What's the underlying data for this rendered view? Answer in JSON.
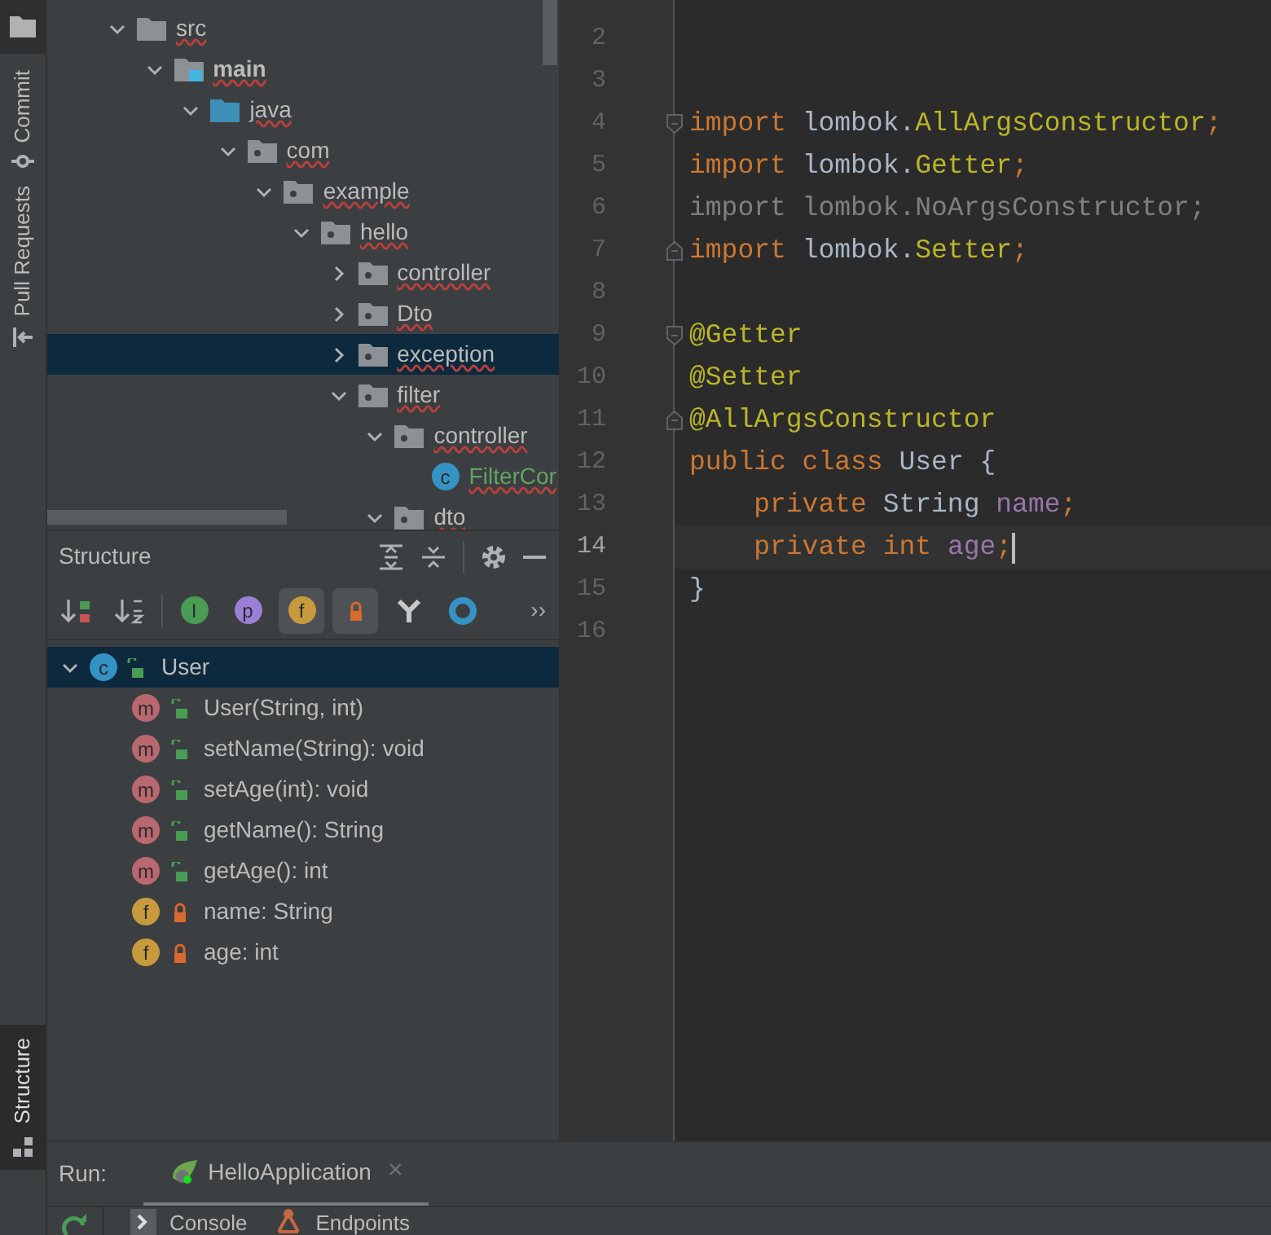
{
  "left_stripe": [
    {
      "label": "Commit",
      "kind": "commit"
    },
    {
      "label": "Pull Requests",
      "kind": "pull"
    }
  ],
  "left_stripe_bottom": {
    "label": "Structure",
    "selected": true
  },
  "project_tree": [
    {
      "label": "src",
      "kind": "folder",
      "expanded": true,
      "selected": false,
      "children": [
        {
          "label": "main",
          "kind": "source_root",
          "expanded": true,
          "selected": false,
          "children": [
            {
              "label": "java",
              "kind": "source_folder",
              "expanded": true,
              "selected": false,
              "children": [
                {
                  "label": "com",
                  "kind": "package",
                  "expanded": true,
                  "selected": false,
                  "children": [
                    {
                      "label": "example",
                      "kind": "package",
                      "expanded": true,
                      "selected": false,
                      "children": [
                        {
                          "label": "hello",
                          "kind": "package",
                          "expanded": true,
                          "selected": false,
                          "children": [
                            {
                              "label": "controller",
                              "kind": "package",
                              "expanded": false,
                              "selected": false
                            },
                            {
                              "label": "Dto",
                              "kind": "package",
                              "expanded": false,
                              "selected": false
                            },
                            {
                              "label": "exception",
                              "kind": "package",
                              "expanded": false,
                              "selected": true
                            },
                            {
                              "label": "filter",
                              "kind": "package",
                              "expanded": true,
                              "selected": false,
                              "children": [
                                {
                                  "label": "controller",
                                  "kind": "package",
                                  "expanded": true,
                                  "selected": false,
                                  "children": [
                                    {
                                      "label": "FilterCor",
                                      "kind": "class",
                                      "badge": "c",
                                      "selected": false
                                    }
                                  ]
                                },
                                {
                                  "label": "dto",
                                  "kind": "package",
                                  "expanded": true,
                                  "selected": false
                                }
                              ]
                            }
                          ]
                        }
                      ]
                    }
                  ]
                }
              ]
            }
          ]
        }
      ]
    }
  ],
  "structure": {
    "title": "Structure",
    "toolbar": [
      {
        "kind": "sort_visibility",
        "selected": false
      },
      {
        "kind": "sort_alpha",
        "selected": false
      },
      {
        "kind": "letter",
        "glyph": "I",
        "color": "#499c54",
        "selected": false
      },
      {
        "kind": "letter",
        "glyph": "p",
        "color": "#9b7fd6",
        "selected": false
      },
      {
        "kind": "letter",
        "glyph": "f",
        "color": "#c79a3d",
        "selected": true
      },
      {
        "kind": "lock",
        "selected": true
      },
      {
        "kind": "fork",
        "selected": false
      },
      {
        "kind": "ring",
        "selected": false
      }
    ],
    "more": "››",
    "root": {
      "label": "User",
      "badge": "c",
      "expanded": true,
      "selected": true,
      "children": [
        {
          "label": "User(String, int)",
          "kind": "method",
          "badge": "m",
          "locked": false
        },
        {
          "label": "setName(String): void",
          "kind": "method",
          "badge": "m",
          "locked": false
        },
        {
          "label": "setAge(int): void",
          "kind": "method",
          "badge": "m",
          "locked": false
        },
        {
          "label": "getName(): String",
          "kind": "method",
          "badge": "m",
          "locked": false
        },
        {
          "label": "getAge(): int",
          "kind": "method",
          "badge": "m",
          "locked": false
        },
        {
          "label": "name: String",
          "kind": "field",
          "badge": "f",
          "locked": true
        },
        {
          "label": "age: int",
          "kind": "field",
          "badge": "f",
          "locked": true
        }
      ]
    }
  },
  "editor": {
    "lines": [
      {
        "number": "2",
        "current": false
      },
      {
        "number": "3",
        "current": false
      },
      {
        "number": "4",
        "current": false,
        "fold_start": true,
        "tokens": [
          {
            "t": "import ",
            "kind": "keyword"
          },
          {
            "t": "lombok.",
            "kind": "plain"
          },
          {
            "t": "AllArgsConstructor",
            "kind": "annotation"
          },
          {
            "t": ";",
            "kind": "keyword"
          }
        ]
      },
      {
        "number": "5",
        "current": false,
        "tokens": [
          {
            "t": "import ",
            "kind": "keyword"
          },
          {
            "t": "lombok.",
            "kind": "plain"
          },
          {
            "t": "Getter",
            "kind": "annotation"
          },
          {
            "t": ";",
            "kind": "keyword"
          }
        ]
      },
      {
        "number": "6",
        "current": false,
        "tokens": [
          {
            "t": "import lombok.NoArgsConstructor;",
            "kind": "unused"
          }
        ]
      },
      {
        "number": "7",
        "current": false,
        "fold_end": true,
        "tokens": [
          {
            "t": "import ",
            "kind": "keyword"
          },
          {
            "t": "lombok.",
            "kind": "plain"
          },
          {
            "t": "Setter",
            "kind": "annotation"
          },
          {
            "t": ";",
            "kind": "keyword"
          }
        ]
      },
      {
        "number": "8",
        "current": false
      },
      {
        "number": "9",
        "current": false,
        "fold_start": true,
        "tokens": [
          {
            "t": "@Getter",
            "kind": "annotation"
          }
        ]
      },
      {
        "number": "10",
        "current": false,
        "tokens": [
          {
            "t": "@Setter",
            "kind": "annotation"
          }
        ]
      },
      {
        "number": "11",
        "current": false,
        "fold_end": true,
        "tokens": [
          {
            "t": "@AllArgsConstructor",
            "kind": "annotation"
          }
        ]
      },
      {
        "number": "12",
        "current": false,
        "tokens": [
          {
            "t": "public class ",
            "kind": "keyword"
          },
          {
            "t": "User {",
            "kind": "plain"
          }
        ]
      },
      {
        "number": "13",
        "current": false,
        "tokens": [
          {
            "t": "    private ",
            "kind": "keyword"
          },
          {
            "t": "String ",
            "kind": "plain"
          },
          {
            "t": "name",
            "kind": "field"
          },
          {
            "t": ";",
            "kind": "keyword"
          }
        ]
      },
      {
        "number": "14",
        "current": true,
        "tokens": [
          {
            "t": "    private int ",
            "kind": "keyword"
          },
          {
            "t": "age",
            "kind": "field"
          },
          {
            "t": ";",
            "kind": "keyword"
          }
        ]
      },
      {
        "number": "15",
        "current": false,
        "tokens": [
          {
            "t": "}",
            "kind": "plain"
          }
        ]
      },
      {
        "number": "16",
        "current": false
      }
    ]
  },
  "run_bar": {
    "label": "Run:",
    "tabs": [
      {
        "label": "HelloApplication",
        "close": "×",
        "selected": true
      }
    ]
  },
  "bottom_tabs": [
    {
      "label": "Console",
      "kind": "console"
    },
    {
      "label": "Endpoints",
      "kind": "endpoints"
    }
  ]
}
